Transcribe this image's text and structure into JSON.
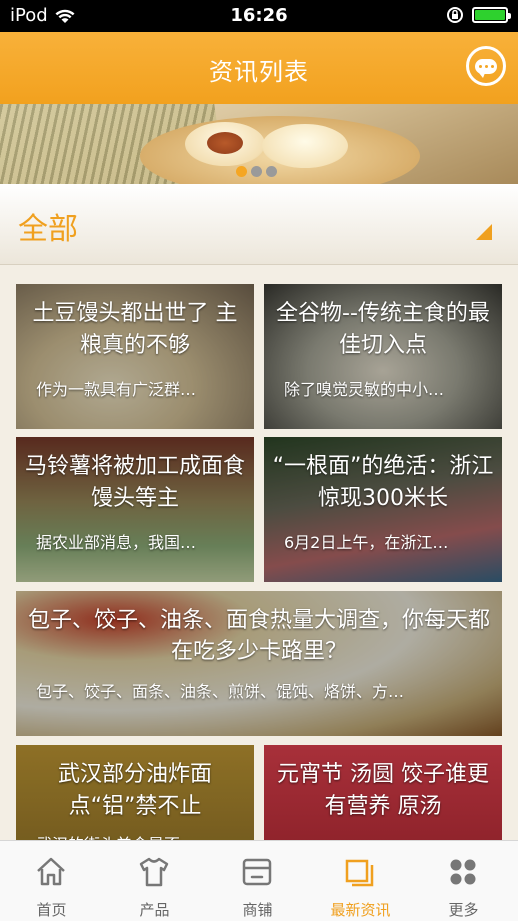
{
  "status_bar": {
    "carrier": "iPod",
    "time": "16:26"
  },
  "header": {
    "title": "资讯列表",
    "message_icon": "chat-bubble-icon"
  },
  "banner": {
    "dots": 3,
    "active_dot": 1
  },
  "category": {
    "label": "全部"
  },
  "articles": [
    {
      "title": "土豆馒头都出世了 主粮真的不够",
      "summary": "作为一款具有广泛群…"
    },
    {
      "title": "全谷物--传统主食的最佳切入点",
      "summary": "除了嗅觉灵敏的中小…"
    },
    {
      "title": "马铃薯将被加工成面食馒头等主",
      "summary": "据农业部消息，我国…"
    },
    {
      "title": "“一根面”的绝活：浙江惊现300米长",
      "summary": "6月2日上午，在浙江…"
    },
    {
      "title": "包子、饺子、油条、面食热量大调查，你每天都在吃多少卡路里？",
      "summary": "包子、饺子、面条、油条、煎饼、馄饨、烙饼、方…"
    },
    {
      "title": "武汉部分油炸面点“铝”禁不止",
      "summary": "武汉的街头美食是否…"
    },
    {
      "title": "元宵节 汤圆 饺子谁更有营养 原汤",
      "summary": ""
    }
  ],
  "tabs": [
    {
      "label": "首页",
      "icon": "home-icon"
    },
    {
      "label": "产品",
      "icon": "shirt-icon"
    },
    {
      "label": "商铺",
      "icon": "store-icon"
    },
    {
      "label": "最新资讯",
      "icon": "news-icon",
      "active": true
    },
    {
      "label": "更多",
      "icon": "grid-icon"
    }
  ],
  "colors": {
    "accent": "#f5a623",
    "tab_active": "#f0a01f"
  }
}
